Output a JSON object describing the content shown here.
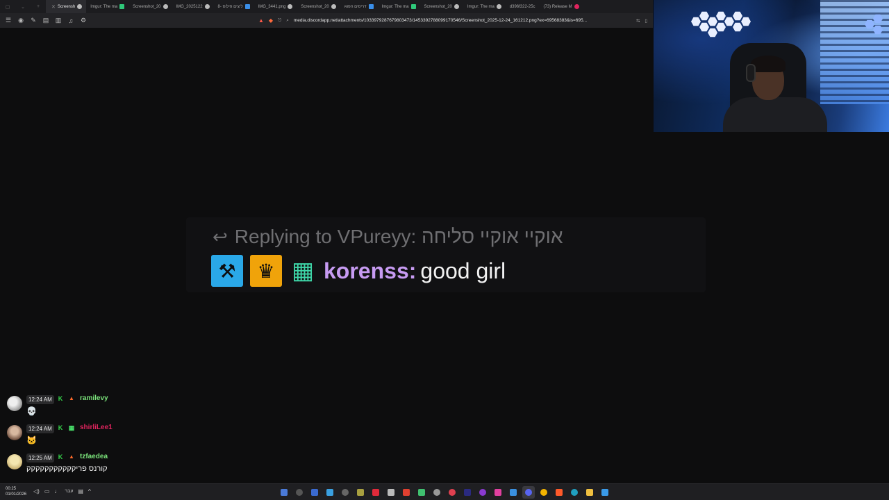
{
  "tabs": [
    "Screensh",
    "Imgur: The ma",
    "Screenshot_20",
    "IMG_2025122",
    "8- ליצים פילוס",
    "IMG_3441.png",
    "Screenshot_20",
    "דריסים הפוא",
    "Imgur: The ma",
    "Screenshot_20",
    "Imgur: The ma",
    "d396f322-25c",
    "(73) Release M"
  ],
  "browser": {
    "url": "media.discordapp.net/attachments/1033979287679803473/1453392788099170546/Screenshot_2025-12-24_161212.png?ex=69568383&is=695..."
  },
  "zoomed": {
    "reply_text": "Replying to VPureyy: אוקיי אוקיי סליחה",
    "username": "korenss:",
    "message": "good girl"
  },
  "chat": [
    {
      "time": "12:24 AM",
      "user": "ramilevy",
      "text": "💀"
    },
    {
      "time": "12:24 AM",
      "user": "shirliLee1",
      "text": "🐱"
    },
    {
      "time": "12:25 AM",
      "user": "tzfaedea",
      "text": "קורנס פריקקקקקקקקקקק"
    }
  ],
  "taskbar": {
    "time": "00:25",
    "date": "01/01/2026",
    "lang": "עבר"
  },
  "colors": {
    "mod_badge": "#2aa8e8",
    "crown_badge": "#f0a30a",
    "gift_badge": "#3ed6a8",
    "username_purple": "#c79bf2",
    "chat_green": "#7be37b",
    "chat_red": "#e0245e"
  }
}
